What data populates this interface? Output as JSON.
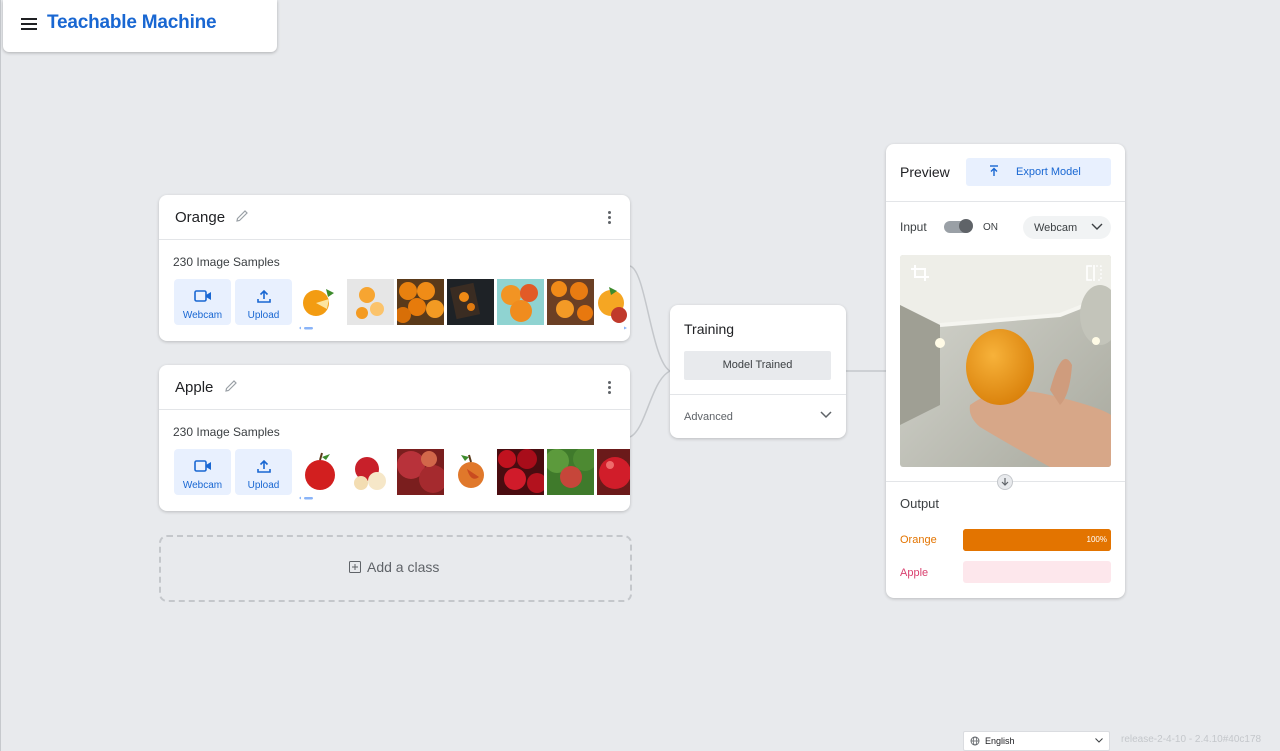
{
  "header": {
    "title": "Teachable Machine"
  },
  "classes": [
    {
      "name": "Orange",
      "samples_label": "230 Image Samples",
      "webcam_label": "Webcam",
      "upload_label": "Upload",
      "thumbnails": [
        "orange-slices-icon",
        "orange-cross-section",
        "orange-pile",
        "orange-dark-board",
        "orange-halves",
        "orange-tray",
        "orange-partial"
      ]
    },
    {
      "name": "Apple",
      "samples_label": "230 Image Samples",
      "webcam_label": "Webcam",
      "upload_label": "Upload",
      "thumbnails": [
        "red-apple",
        "apple-slices",
        "apples-closeup",
        "single-apple",
        "apple-pile",
        "apple-on-tree",
        "apple-partial"
      ]
    }
  ],
  "add_class_label": "Add a class",
  "training": {
    "title": "Training",
    "button_label": "Model Trained",
    "advanced_label": "Advanced"
  },
  "preview": {
    "title": "Preview",
    "export_label": "Export Model",
    "input_label": "Input",
    "toggle_state": "ON",
    "source_label": "Webcam",
    "output_title": "Output",
    "outputs": [
      {
        "label": "Orange",
        "confidence": 1.0,
        "percent_text": "100%",
        "color": "#e37400",
        "bg": "#e37400"
      },
      {
        "label": "Apple",
        "confidence": 0.0,
        "percent_text": "",
        "color": "#d93f6e",
        "bg": "#fde7ec"
      }
    ]
  },
  "footer": {
    "language": "English",
    "release": "release-2-4-10 - 2.4.10#40c178"
  },
  "colors": {
    "accent": "#1967d2",
    "orange": "#e37400",
    "apple": "#d93f6e",
    "background": "#e8eaed"
  }
}
